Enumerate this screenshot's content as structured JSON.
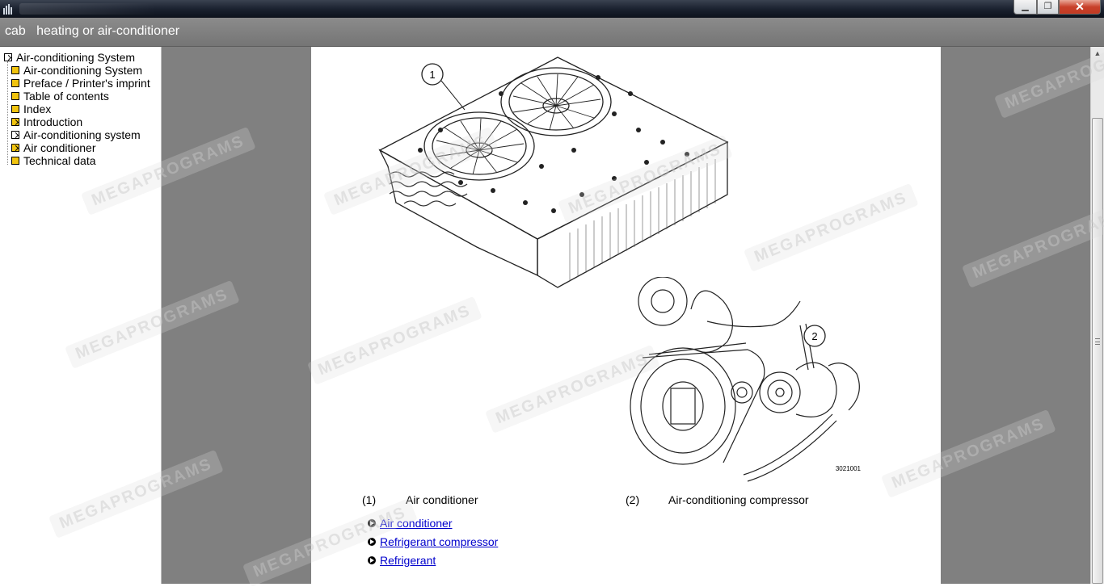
{
  "breadcrumb": "cab   heating or air-conditioner",
  "window_buttons": {
    "minimize": "▁",
    "maximize": "❐",
    "close": "✕"
  },
  "tree": [
    {
      "label": "Air-conditioning System",
      "icon": "book-open-icon"
    },
    {
      "label": "Air-conditioning System",
      "icon": "page-icon"
    },
    {
      "label": "Preface / Printer's imprint",
      "icon": "page-icon"
    },
    {
      "label": "Table of contents",
      "icon": "page-icon"
    },
    {
      "label": "Index",
      "icon": "page-icon"
    },
    {
      "label": "Introduction",
      "icon": "book-closed-icon"
    },
    {
      "label": "Air-conditioning system",
      "icon": "book-open-icon"
    },
    {
      "label": "Air conditioner",
      "icon": "book-closed-icon"
    },
    {
      "label": "Technical data",
      "icon": "page-icon"
    }
  ],
  "figure": {
    "callout_1": "1",
    "callout_2": "2",
    "figure_number": "3021001"
  },
  "captions": [
    {
      "num": "(1)",
      "text": "Air conditioner"
    },
    {
      "num": "(2)",
      "text": "Air-conditioning compressor"
    }
  ],
  "links": [
    {
      "label": "Air conditioner"
    },
    {
      "label": "Refrigerant compressor"
    },
    {
      "label": "Refrigerant"
    }
  ],
  "watermark": "MEGAPROGRAMS"
}
